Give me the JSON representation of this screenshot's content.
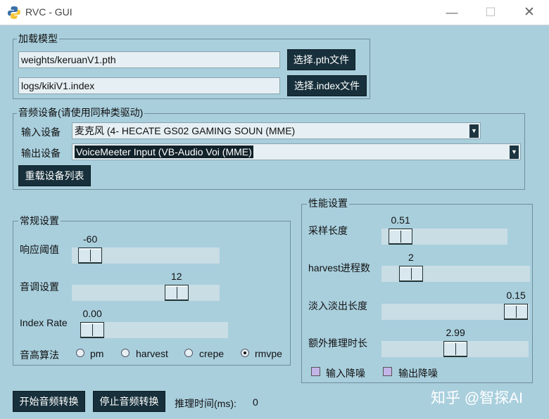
{
  "window": {
    "title": "RVC - GUI",
    "minimize_glyph": "—",
    "maximize_glyph": "☐",
    "close_glyph": "✕"
  },
  "load_model": {
    "legend": "加载模型",
    "pth_path": "weights/keruanV1.pth",
    "pth_button": "选择.pth文件",
    "index_path": "logs/kikiV1.index",
    "index_button": "选择.index文件"
  },
  "audio_devices": {
    "legend": "音频设备(请使用同种类驱动)",
    "input_label": "输入设备",
    "input_value": "麦克风 (4- HECATE GS02 GAMING SOUN (MME)",
    "output_label": "输出设备",
    "output_value": "VoiceMeeter Input (VB-Audio Voi (MME)",
    "reload_button": "重载设备列表",
    "dropdown_icon": "dropdown-arrow-icon"
  },
  "general": {
    "legend": "常规设置",
    "threshold_label": "响应阈值",
    "threshold_value": "-60",
    "threshold_level": 0.05,
    "pitch_label": "音调设置",
    "pitch_value": "12",
    "pitch_level": 0.75,
    "index_rate_label": "Index Rate",
    "index_rate_value": "0.00",
    "index_rate_level": 0.0,
    "f0_label": "音高算法",
    "f0_options": [
      "pm",
      "harvest",
      "crepe",
      "rmvpe"
    ],
    "f0_selected": "rmvpe"
  },
  "performance": {
    "legend": "性能设置",
    "sample_len_label": "采样长度",
    "sample_len_value": "0.51",
    "sample_len_level": 0.07,
    "harvest_label": "harvest进程数",
    "harvest_value": "2",
    "harvest_level": 0.14,
    "crossfade_label": "淡入淡出长度",
    "crossfade_value": "0.15",
    "crossfade_level": 0.99,
    "extra_label": "额外推理时长",
    "extra_value": "2.99",
    "extra_level": 0.5,
    "input_denoise_label": "输入降噪",
    "output_denoise_label": "输出降噪"
  },
  "footer": {
    "start_button": "开始音频转换",
    "stop_button": "停止音频转换",
    "infer_time_label": "推理时间(ms):",
    "infer_time_value": "0"
  },
  "watermark": "知乎 @智探AI",
  "colors": {
    "background": "#a9cfdd",
    "button": "#17303b",
    "checkbox": "#c4b5e8"
  }
}
